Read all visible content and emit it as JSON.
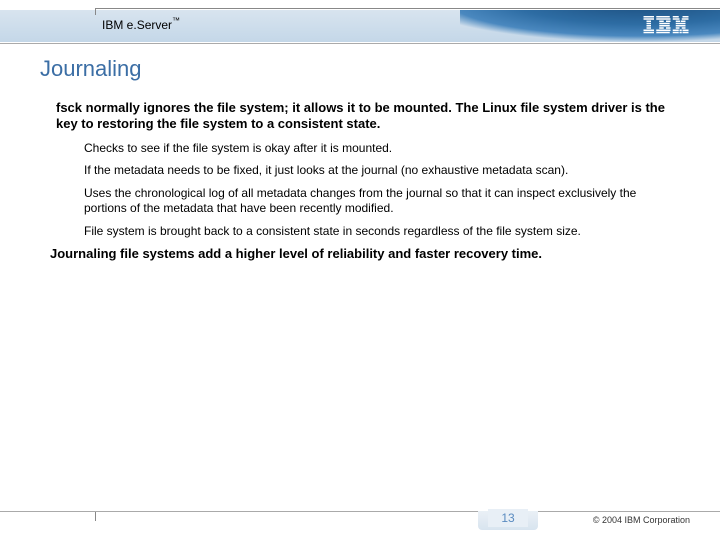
{
  "header": {
    "brand_prefix": "IBM e.",
    "brand_suffix": "Server",
    "brand_tm": "™"
  },
  "title": "Journaling",
  "content": {
    "para1": "fsck normally ignores the file system; it allows it to be mounted. The Linux file system driver is the key to restoring the file system to a consistent state.",
    "sub1": "Checks to see if the file system is okay after it is mounted.",
    "sub2": "If the metadata needs to be fixed, it just looks at the journal (no exhaustive metadata scan).",
    "sub3": "Uses the chronological log of all metadata changes from the journal so that it can inspect exclusively the portions of the metadata that have been recently modified.",
    "sub4": "File system is brought back to a consistent state in seconds regardless of the file system size.",
    "summary": "Journaling file systems add a higher level of reliability and faster recovery time."
  },
  "footer": {
    "page_number": "13",
    "copyright": "© 2004 IBM Corporation"
  }
}
